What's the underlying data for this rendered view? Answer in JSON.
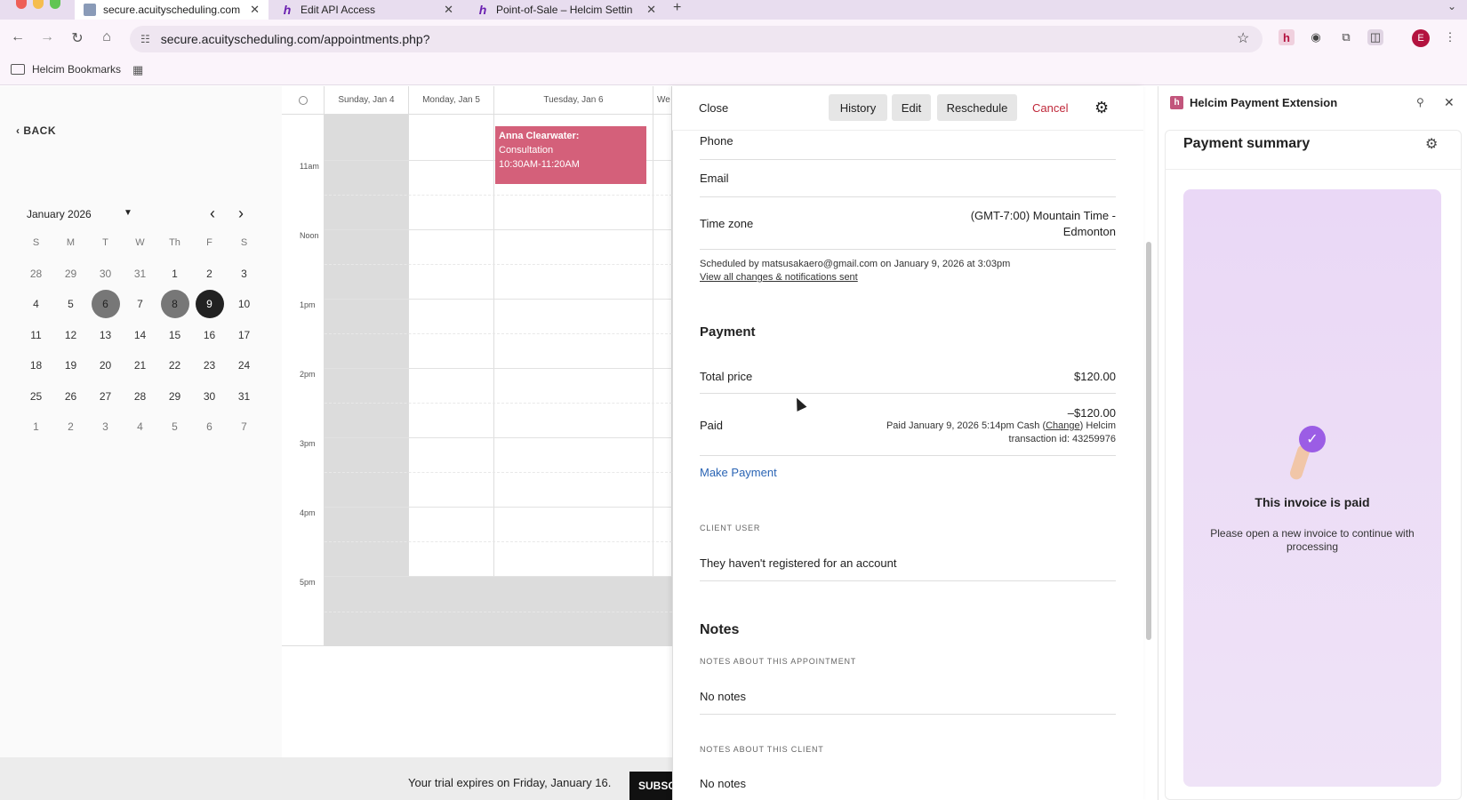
{
  "browser": {
    "tabs": [
      {
        "title": "secure.acuityscheduling.com",
        "active": true
      },
      {
        "title": "Edit API Access",
        "active": false
      },
      {
        "title": "Point-of-Sale – Helcim Settin",
        "active": false
      }
    ],
    "url": "secure.acuityscheduling.com/appointments.php?",
    "bookmarks_folder": "Helcim Bookmarks",
    "profile_initial": "E",
    "traffic_colors": [
      "#ee5f57",
      "#f5bd4f",
      "#61c554"
    ]
  },
  "left_panel": {
    "back_label": "BACK",
    "month_label": "January 2026",
    "weekday_headers": [
      "S",
      "M",
      "T",
      "W",
      "Th",
      "F",
      "S"
    ],
    "weeks": [
      [
        "28",
        "29",
        "30",
        "31",
        "1",
        "2",
        "3"
      ],
      [
        "4",
        "5",
        "6",
        "7",
        "8",
        "9",
        "10"
      ],
      [
        "11",
        "12",
        "13",
        "14",
        "15",
        "16",
        "17"
      ],
      [
        "18",
        "19",
        "20",
        "21",
        "22",
        "23",
        "24"
      ],
      [
        "25",
        "26",
        "27",
        "28",
        "29",
        "30",
        "31"
      ],
      [
        "1",
        "2",
        "3",
        "4",
        "5",
        "6",
        "7"
      ]
    ]
  },
  "week_calendar": {
    "day_headers": [
      "Sunday, Jan 4",
      "Monday, Jan 5",
      "Tuesday, Jan 6",
      "We"
    ],
    "time_labels": [
      "11am",
      "Noon",
      "1pm",
      "2pm",
      "3pm",
      "4pm",
      "5pm"
    ],
    "event": {
      "name": "Anna Clearwater:",
      "type": "Consultation",
      "time": "10:30AM-11:20AM",
      "color": "#d4607a"
    }
  },
  "trial_bar": {
    "text": "Your trial expires on Friday, January 16.",
    "button": "SUBSC"
  },
  "detail": {
    "close_label": "Close",
    "history_label": "History",
    "edit_label": "Edit",
    "reschedule_label": "Reschedule",
    "cancel_label": "Cancel",
    "phone_label": "Phone",
    "email_label": "Email",
    "timezone_label": "Time zone",
    "timezone_line1": "(GMT-7:00) Mountain Time -",
    "timezone_line2": "Edmonton",
    "scheduled_by": "Scheduled by matsusakaero@gmail.com on January 9, 2026 at 3:03pm",
    "view_changes": "View all changes & notifications sent",
    "payment_title": "Payment",
    "total_price_label": "Total price",
    "total_price_value": "$120.00",
    "paid_label": "Paid",
    "paid_value": "–$120.00",
    "paid_detail_prefix": "Paid January 9, 2026 5:14pm Cash (",
    "paid_change": "Change",
    "paid_detail_suffix": ") Helcim",
    "paid_transaction": "transaction id: 43259976",
    "make_payment": "Make Payment",
    "client_user_caps": "CLIENT USER",
    "client_user_text": "They haven't registered for an account",
    "notes_title": "Notes",
    "notes_appt_caps": "NOTES ABOUT THIS APPOINTMENT",
    "notes_appt_text": "No notes",
    "notes_client_caps": "NOTES ABOUT THIS CLIENT",
    "notes_client_text": "No notes"
  },
  "extension": {
    "title": "Helcim Payment Extension",
    "summary_title": "Payment summary",
    "paid_title": "This invoice is paid",
    "paid_sub": "Please open a new invoice to continue with processing"
  }
}
